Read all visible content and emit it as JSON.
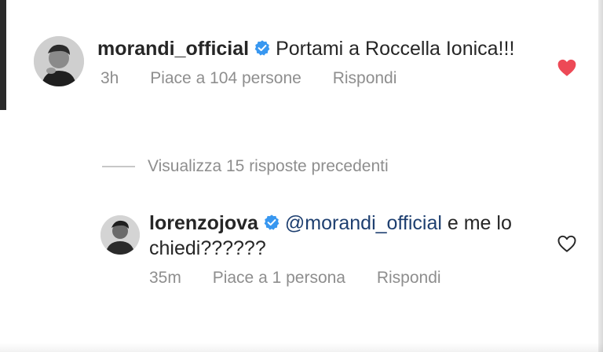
{
  "comments": [
    {
      "username": "morandi_official",
      "verified": true,
      "text": "Portami a Roccella Ionica!!!",
      "time": "3h",
      "likes_label": "Piace a 104 persone",
      "reply_label": "Rispondi",
      "liked": true,
      "heart_color": "#ed4956"
    },
    {
      "username": "lorenzojova",
      "verified": true,
      "mention": "@morandi_official",
      "text": " e me lo chiedi??????",
      "time": "35m",
      "likes_label": "Piace a 1 persona",
      "reply_label": "Rispondi",
      "liked": false
    }
  ],
  "view_replies_label": "Visualizza 15 risposte precedenti",
  "colors": {
    "verified_badge": "#3897f0",
    "mention": "#1e3f70",
    "meta_text": "#8e8e8e"
  }
}
